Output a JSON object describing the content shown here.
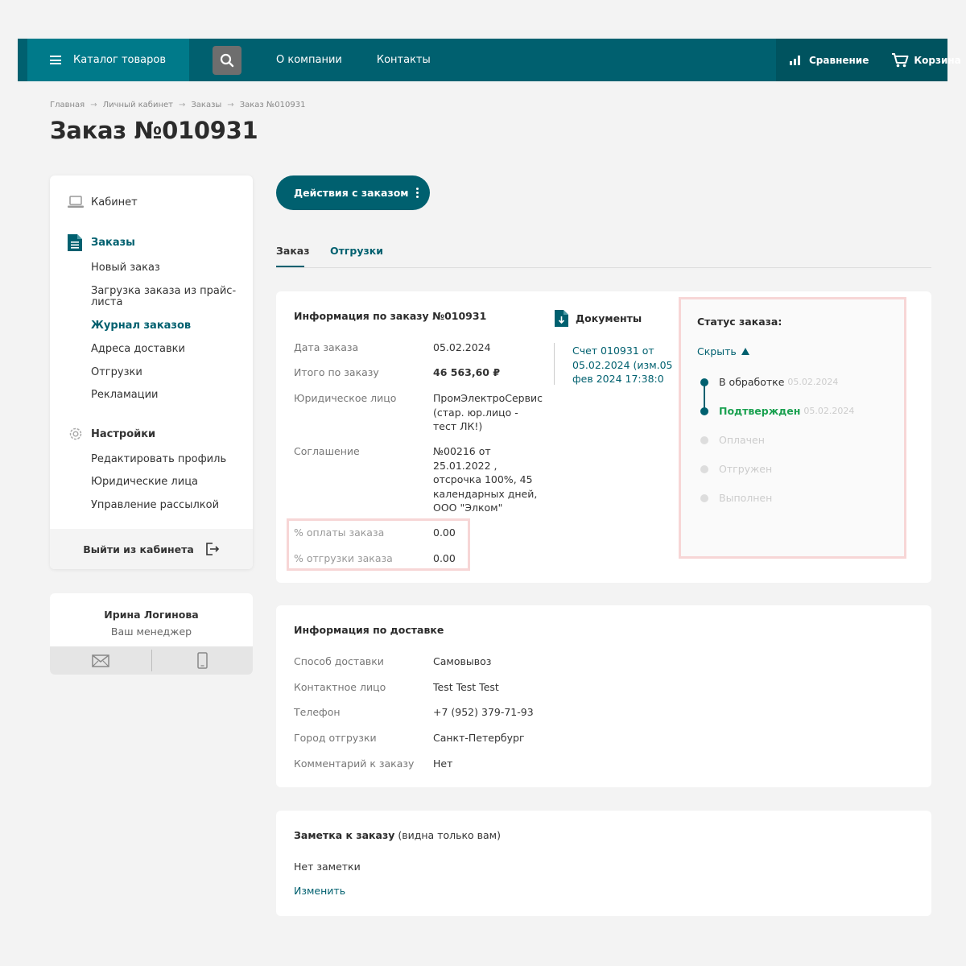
{
  "colors": {
    "brand": "#00606f",
    "brand_dark": "#00535f",
    "success": "#1aa150",
    "highlight": "#f7d6d6"
  },
  "topbar": {
    "catalog_label": "Каталог товаров",
    "nav": [
      "О компании",
      "Контакты"
    ],
    "compare_label": "Сравнение",
    "cart_label": "Корзина"
  },
  "breadcrumb": [
    "Главная",
    "Личный кабинет",
    "Заказы",
    "Заказ №010931"
  ],
  "breadcrumb_separator": "→",
  "page_title": "Заказ №010931",
  "sidebar": {
    "cabinet": "Кабинет",
    "orders": {
      "label": "Заказы",
      "items": [
        "Новый заказ",
        "Загрузка заказа из прайс-листа",
        "Журнал заказов",
        "Адреса доставки",
        "Отгрузки",
        "Рекламации"
      ]
    },
    "settings": {
      "label": "Настройки",
      "items": [
        "Редактировать профиль",
        "Юридические лица",
        "Управление рассылкой"
      ]
    },
    "logout": "Выйти из кабинета"
  },
  "manager": {
    "name": "Ирина Логинова",
    "role": "Ваш менеджер"
  },
  "actions_button": "Действия с заказом",
  "tabs": [
    "Заказ",
    "Отгрузки"
  ],
  "order_info": {
    "title": "Информация по заказу №010931",
    "rows": [
      {
        "label": "Дата заказа",
        "value": "05.02.2024"
      },
      {
        "label": "Итого по заказу",
        "value": "46 563,60 ₽"
      },
      {
        "label": "Юридическое лицо",
        "value": "ПромЭлектроСервис (стар. юр.лицо - тест ЛК!)"
      },
      {
        "label": "Соглашение",
        "value": "№00216 от 25.01.2022 , отсрочка 100%, 45 календарных дней, ООО \"Элком\""
      },
      {
        "label": "% оплаты заказа",
        "value": "0.00"
      },
      {
        "label": "% отгрузки заказа",
        "value": "0.00"
      }
    ]
  },
  "documents": {
    "title": "Документы",
    "link": "Счет 010931 от 05.02.2024 (изм.05 фев 2024 17:38:0"
  },
  "status": {
    "title": "Статус заказа:",
    "toggle": "Скрыть",
    "steps": [
      {
        "name": "В обработке",
        "date": "05.02.2024"
      },
      {
        "name": "Подтвержден",
        "date": "05.02.2024"
      },
      {
        "name": "Оплачен",
        "date": ""
      },
      {
        "name": "Отгружен",
        "date": ""
      },
      {
        "name": "Выполнен",
        "date": ""
      }
    ]
  },
  "delivery": {
    "title": "Информация по доставке",
    "rows": [
      {
        "label": "Способ доставки",
        "value": "Самовывоз"
      },
      {
        "label": "Контактное лицо",
        "value": "Test Test Test"
      },
      {
        "label": "Телефон",
        "value": "+7 (952) 379-71-93"
      },
      {
        "label": "Город отгрузки",
        "value": "Санкт-Петербург"
      },
      {
        "label": "Комментарий к заказу",
        "value": "Нет"
      }
    ]
  },
  "note": {
    "title": "Заметка к заказу",
    "title_suffix": "(видна только вам)",
    "text": "Нет заметки",
    "edit": "Изменить"
  }
}
